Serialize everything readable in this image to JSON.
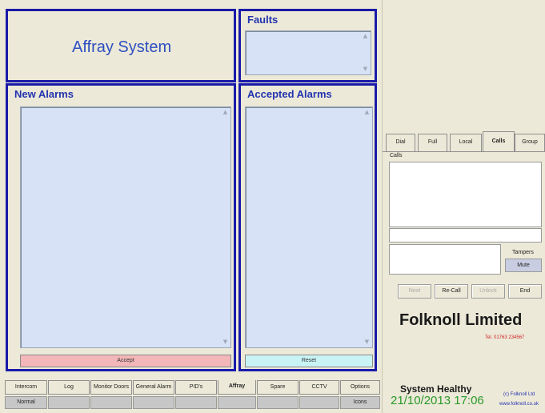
{
  "app": {
    "system_title": "Affray System"
  },
  "panels": {
    "faults": "Faults",
    "new_alarms": "New Alarms",
    "accepted_alarms": "Accepted Alarms"
  },
  "buttons": {
    "accept": "Accept",
    "reset": "Reset"
  },
  "scroll": {
    "up": "▲",
    "down": "▼"
  },
  "tabs": [
    "Dial",
    "Full",
    "Local",
    "Calls",
    "Group"
  ],
  "active_tab": "Calls",
  "calls": {
    "label": "Calls",
    "tampers": "Tampers",
    "mute": "Mute"
  },
  "call_controls": [
    "Next",
    "Re-Call",
    "Unlock",
    "End"
  ],
  "company": {
    "name": "Folknoll Limited",
    "tel": "Tel. 01763 234567",
    "copyright": "(c) Folknoll Ltd",
    "website": "www.folknoll.co.uk"
  },
  "status": {
    "health": "System Healthy",
    "datetime": "21/10/2013 17:06"
  },
  "bottom_tabs": [
    "Intercom",
    "Log",
    "Monitor Doors",
    "General Alarm",
    "PID's",
    "Affray",
    "Spare",
    "CCTV",
    "Options"
  ],
  "active_bottom_tab": "Affray",
  "bottom_buttons": {
    "normal": "Normal",
    "icons": "Icons"
  },
  "colors": {
    "panel_border": "#1a1aa8",
    "accent_title": "#2e4fc1",
    "accept_button": "#f3b6b9",
    "reset_button": "#c9f4f6",
    "datetime_green": "#2a9a2a",
    "tel_red": "#d02020"
  }
}
